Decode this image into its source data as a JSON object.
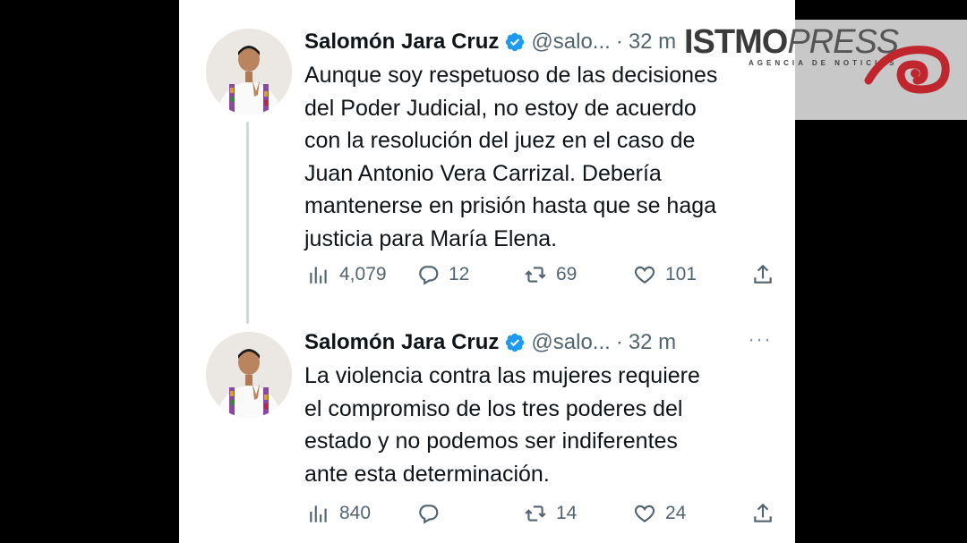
{
  "tweets": [
    {
      "name": "Salomón Jara Cruz",
      "handle": "@salo...",
      "dot": "·",
      "time": "32 m",
      "more": "···",
      "text_lines": [
        "Aunque soy respetuoso de las decisiones",
        "del Poder Judicial, no estoy de acuerdo",
        "con la resolución del juez en el caso de",
        "Juan Antonio Vera Carrizal. Debería",
        "mantenerse en prisión hasta que se haga",
        "justicia para María Elena."
      ],
      "views": "4,079",
      "replies": "12",
      "retweets": "69",
      "likes": "101"
    },
    {
      "name": "Salomón Jara Cruz",
      "handle": "@salo...",
      "dot": "·",
      "time": "32 m",
      "more": "···",
      "text_lines": [
        "La violencia contra las mujeres requiere",
        "el compromiso de los tres poderes del",
        "estado y no podemos ser indiferentes",
        "ante esta determinación."
      ],
      "views": "840",
      "replies": "",
      "retweets": "14",
      "likes": "24"
    }
  ],
  "watermark": {
    "brand_main": "ISTMO",
    "brand_press": "PRESS",
    "tagline": "AGENCIA DE NOTICIAS"
  },
  "colors": {
    "verified": "#1d9bf0",
    "text": "#0f1419",
    "secondary": "#536471",
    "watermark_red": "#c0262d"
  },
  "icons": [
    "verified-badge-icon",
    "views-icon",
    "reply-icon",
    "retweet-icon",
    "like-icon",
    "share-icon"
  ]
}
